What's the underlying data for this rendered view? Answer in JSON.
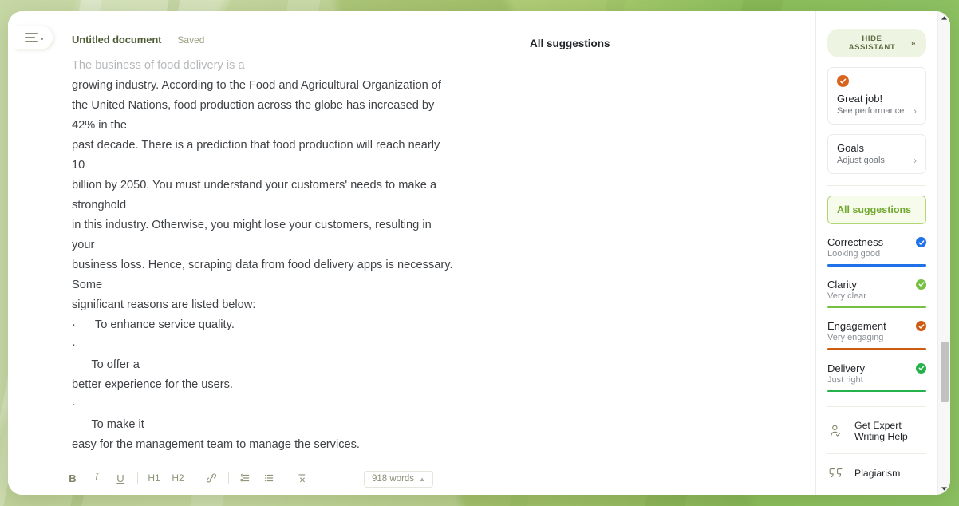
{
  "background": {
    "color": "#a8c46a",
    "accent": "#8cc061"
  },
  "window": {
    "menu_button": "menu-icon",
    "document": {
      "title": "Untitled document",
      "save_status": "Saved"
    },
    "center_heading": "All suggestions"
  },
  "document_text": [
    {
      "text": "The business of food delivery is a",
      "faded": true
    },
    {
      "text": "growing industry. According to the Food and Agricultural Organization of",
      "faded": false
    },
    {
      "text": "the United Nations, food production across the globe has increased by",
      "faded": false
    },
    {
      "text": "42% in the",
      "faded": false
    },
    {
      "text": "past decade. There is a prediction that food production will reach nearly",
      "faded": false
    },
    {
      "text": "10",
      "faded": false
    },
    {
      "text": "billion by 2050. You must understand your customers' needs to make a",
      "faded": false
    },
    {
      "text": "stronghold",
      "faded": false
    },
    {
      "text": "in this industry. Otherwise, you might lose your customers, resulting in",
      "faded": false
    },
    {
      "text": "your",
      "faded": false
    },
    {
      "text": "business loss. Hence, scraping data from food delivery apps is necessary.",
      "faded": false
    },
    {
      "text": "Some",
      "faded": false
    },
    {
      "text": "significant reasons are listed below:",
      "faded": false
    },
    {
      "text": "·      To enhance service quality.",
      "faded": false
    },
    {
      "text": "·",
      "faded": false
    },
    {
      "text": "      To offer a",
      "faded": false
    },
    {
      "text": "better experience for the users.",
      "faded": false
    },
    {
      "text": "·",
      "faded": false
    },
    {
      "text": "      To make it",
      "faded": false
    },
    {
      "text": "easy for the management team to manage the services.",
      "faded": false
    }
  ],
  "toolbar": {
    "bold": "B",
    "italic": "I",
    "underline": "U",
    "heading1": "H1",
    "heading2": "H2",
    "link": "link-icon",
    "ordered_list": "ordered-list-icon",
    "bullet_list": "bullet-list-icon",
    "clear_format": "clear-format-icon",
    "word_count": "918 words",
    "word_count_caret": "▲"
  },
  "assistant": {
    "hide_button": {
      "label": "HIDE ASSISTANT",
      "chevron": "»"
    },
    "cards": [
      {
        "title": "Great job!",
        "subtitle": "See performance",
        "badge": "check-badge",
        "badge_color": "#d9641e",
        "chevron": "›"
      },
      {
        "title": "Goals",
        "subtitle": "Adjust goals",
        "badge": null,
        "chevron": "›"
      }
    ],
    "all_suggestions_button": "All suggestions",
    "metrics": [
      {
        "name": "Correctness",
        "status": "Looking good",
        "color": "#1f72e8"
      },
      {
        "name": "Clarity",
        "status": "Very clear",
        "color": "#76c043"
      },
      {
        "name": "Engagement",
        "status": "Very engaging",
        "color": "#cf5a12"
      },
      {
        "name": "Delivery",
        "status": "Just right",
        "color": "#25b24b"
      }
    ],
    "links": [
      {
        "line1": "Get Expert",
        "line2": "Writing Help",
        "icon": "expert-writer-icon"
      },
      {
        "line1": "Plagiarism",
        "line2": "",
        "icon": "quote-icon"
      }
    ],
    "scrollbar": {
      "up_arrow": "▲",
      "down_arrow": "▼"
    }
  }
}
